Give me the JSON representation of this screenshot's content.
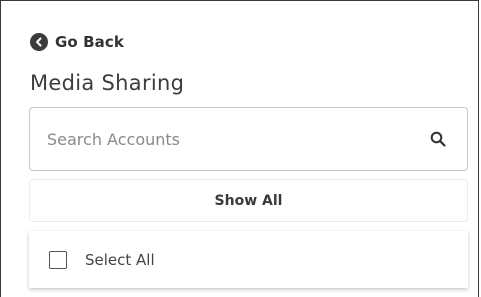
{
  "nav": {
    "back_label": "Go Back",
    "back_icon": "chevron-left-circle-icon"
  },
  "page": {
    "title": "Media Sharing"
  },
  "search": {
    "placeholder": "Search Accounts",
    "value": "",
    "icon": "search-icon"
  },
  "actions": {
    "show_all_label": "Show All"
  },
  "selection": {
    "select_all_label": "Select All",
    "checked": false
  },
  "colors": {
    "text": "#333333",
    "icon_dark": "#3b3b3b",
    "border": "#c7c7c7"
  }
}
